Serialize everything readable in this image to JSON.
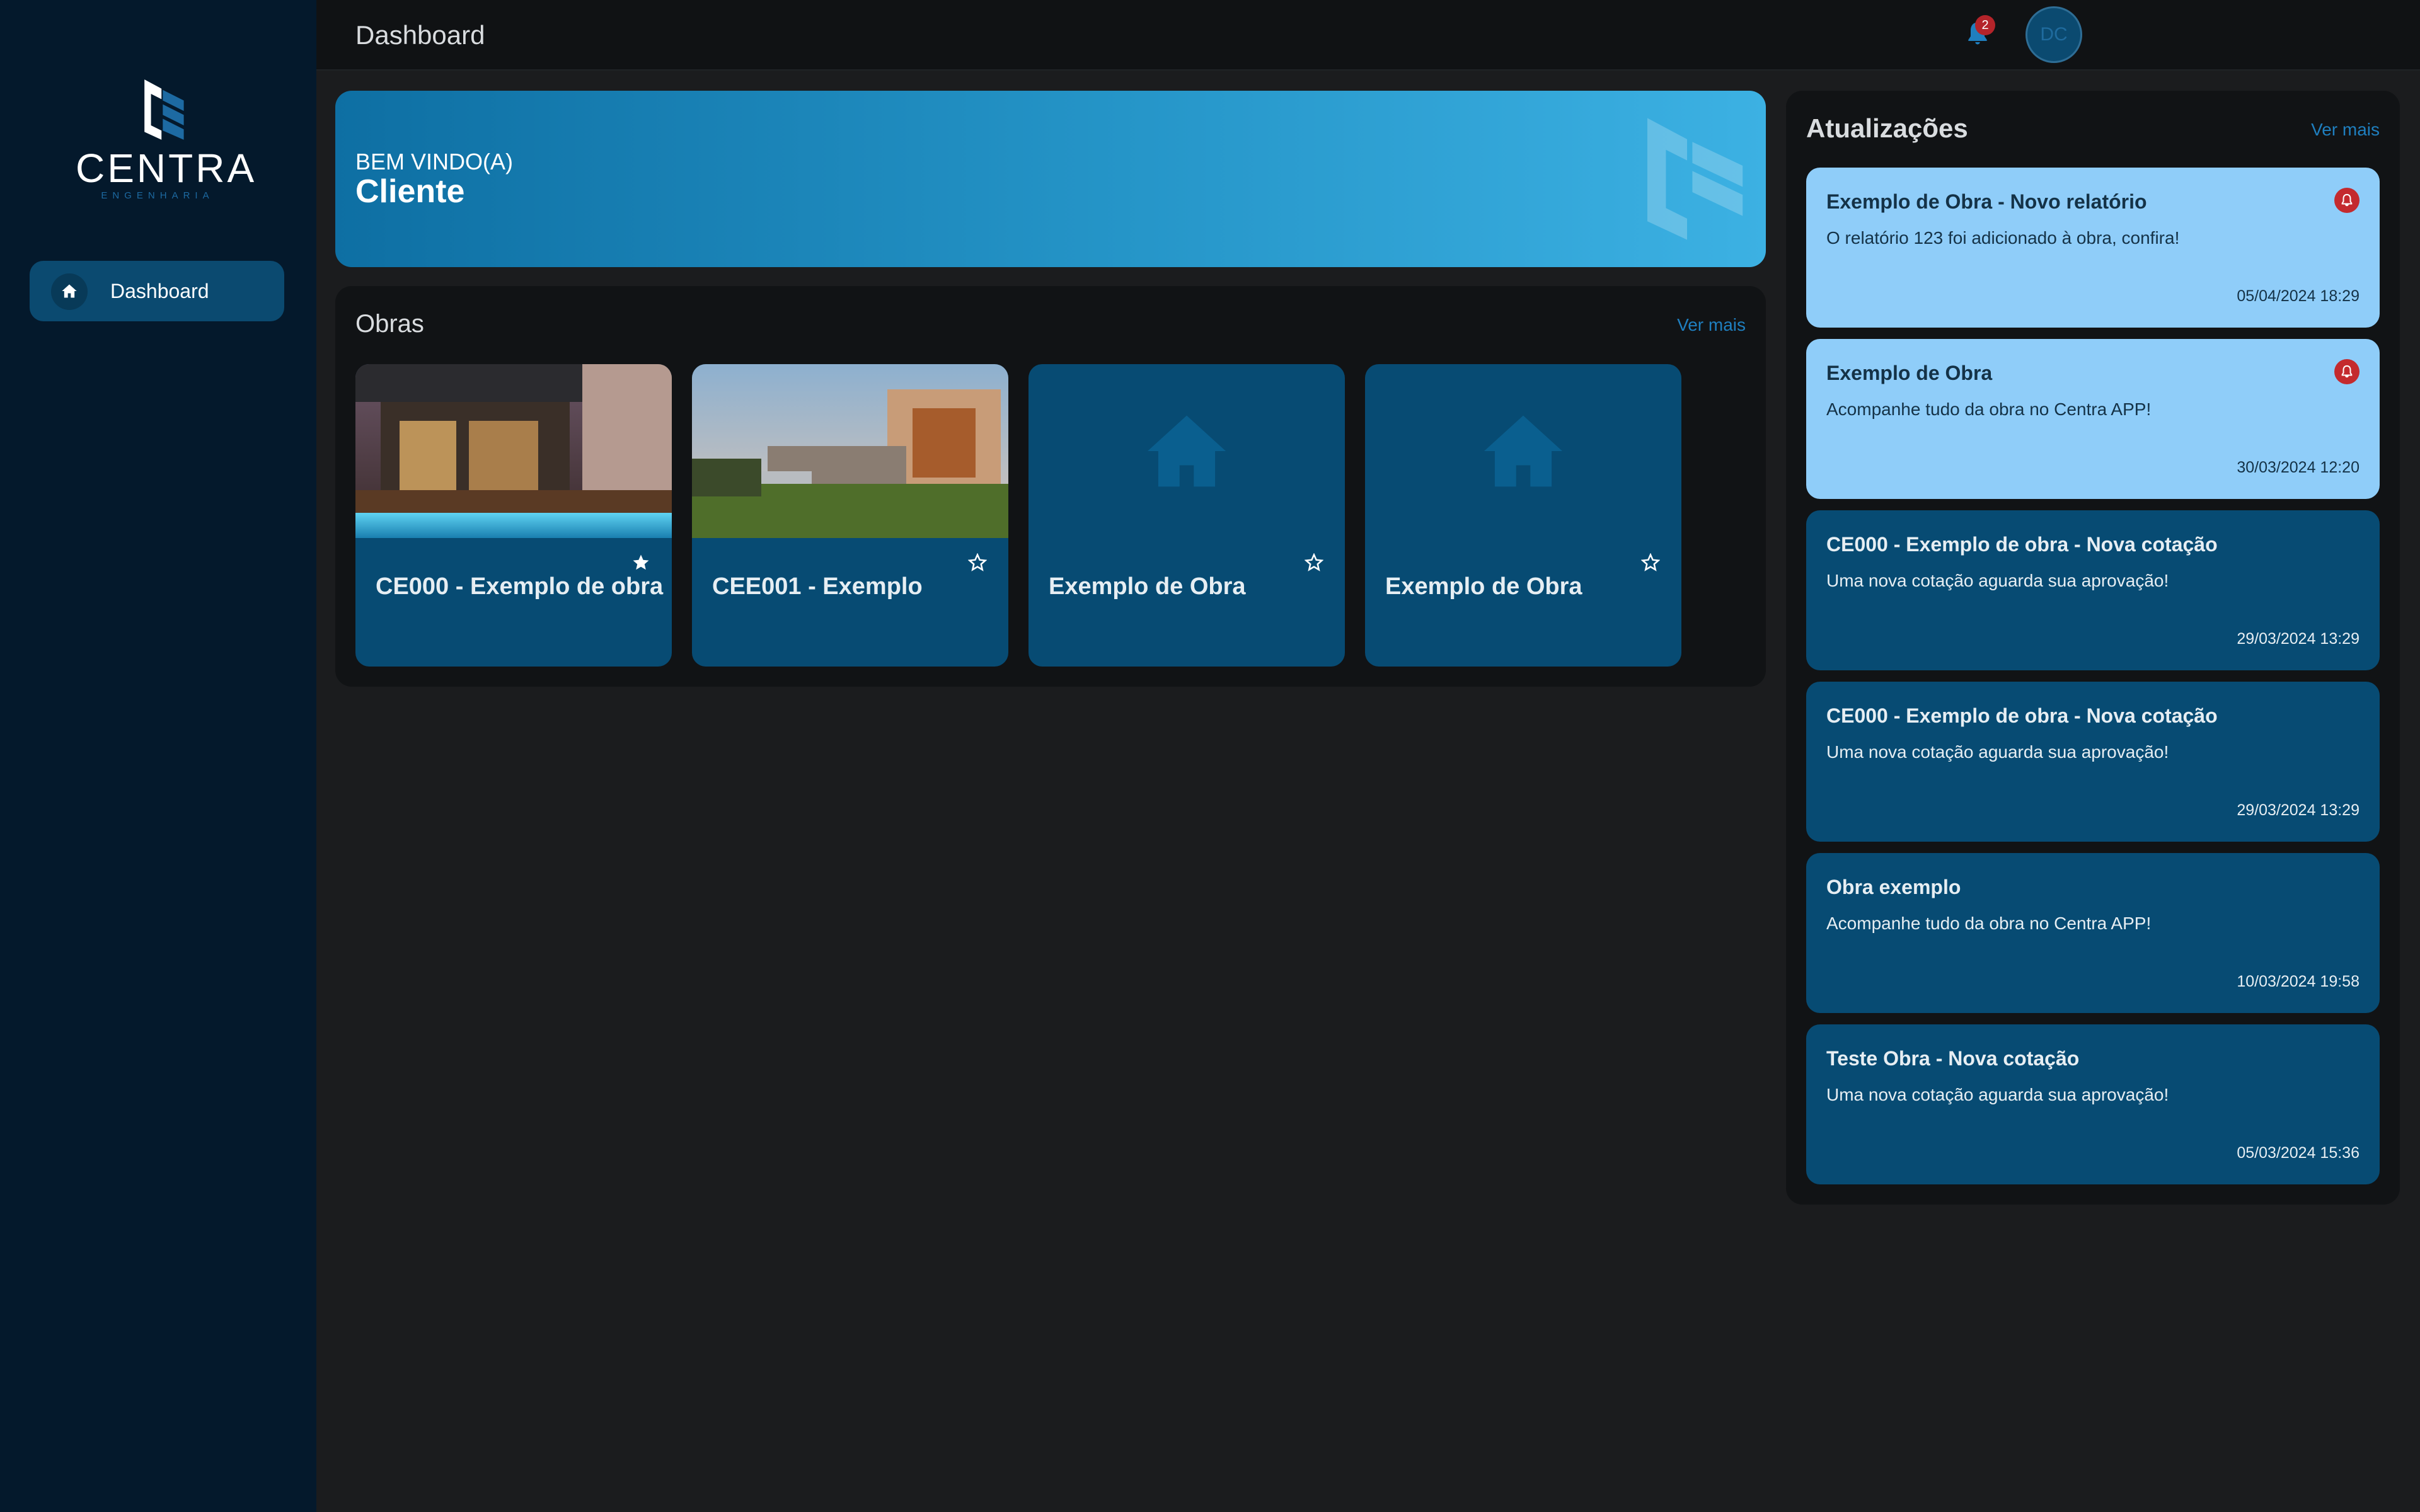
{
  "brand": {
    "name": "CENTRA",
    "tagline": "ENGENHARIA"
  },
  "sidebar": {
    "items": [
      {
        "label": "Dashboard",
        "icon": "home-icon",
        "active": true
      }
    ]
  },
  "header": {
    "title": "Dashboard",
    "notifications_count": "2",
    "avatar_initials": "DC"
  },
  "welcome": {
    "greeting": "BEM VINDO(A)",
    "user_name": "Cliente"
  },
  "obras": {
    "title": "Obras",
    "see_more": "Ver mais",
    "items": [
      {
        "name": "CE000 - Exemplo de obra",
        "favorite": true,
        "image": "photo"
      },
      {
        "name": "CEE001 - Exemplo",
        "favorite": false,
        "image": "photo"
      },
      {
        "name": "Exemplo de Obra",
        "favorite": false,
        "image": "house-icon"
      },
      {
        "name": "Exemplo de Obra",
        "favorite": false,
        "image": "house-icon"
      }
    ]
  },
  "updates": {
    "title": "Atualizações",
    "see_more": "Ver mais",
    "items": [
      {
        "title": "Exemplo de Obra - Novo relatório",
        "message": "O relatório 123 foi adicionado à obra, confira!",
        "time": "05/04/2024 18:29",
        "unread": true
      },
      {
        "title": "Exemplo de Obra",
        "message": "Acompanhe tudo da obra no Centra APP!",
        "time": "30/03/2024 12:20",
        "unread": true
      },
      {
        "title": "CE000 - Exemplo de obra  - Nova cotação",
        "message": "Uma nova cotação aguarda sua aprovação!",
        "time": "29/03/2024 13:29",
        "unread": false
      },
      {
        "title": "CE000 - Exemplo de obra - Nova cotação",
        "message": "Uma nova cotação aguarda sua aprovação!",
        "time": "29/03/2024 13:29",
        "unread": false
      },
      {
        "title": "Obra exemplo",
        "message": "Acompanhe tudo da obra no Centra APP!",
        "time": "10/03/2024 19:58",
        "unread": false
      },
      {
        "title": "Teste Obra - Nova cotação",
        "message": "Uma nova cotação aguarda sua aprovação!",
        "time": "05/03/2024 15:36",
        "unread": false
      }
    ]
  },
  "colors": {
    "sidebar_bg": "#04192c",
    "accent": "#1f7fbf",
    "card_bg": "#074b73",
    "unread_bg": "#8fcdf9",
    "alert_red": "#c42a2e"
  }
}
